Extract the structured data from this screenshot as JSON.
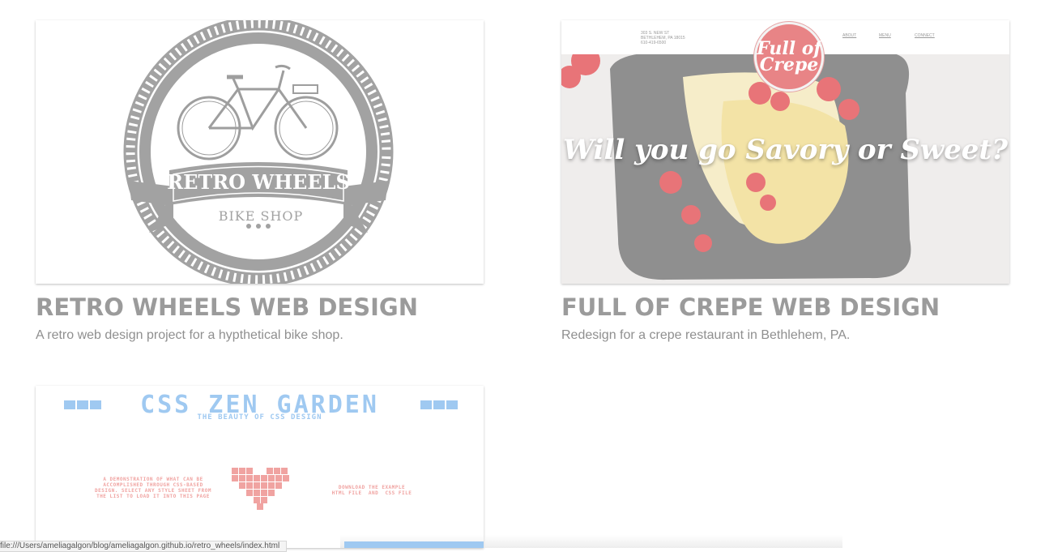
{
  "projects": [
    {
      "title": "RETRO WHEELS WEB DESIGN",
      "description": "A retro web design project for a hypthetical bike shop.",
      "thumbnail": {
        "logo_main_text": "RETRO WHEELS",
        "logo_sub_text": "BIKE SHOP",
        "icon": "bicycle-icon",
        "color": "#9e9e9e"
      }
    },
    {
      "title": "FULL OF CREPE WEB DESIGN",
      "description": "Redesign for a crepe restaurant in Bethlehem, PA.",
      "thumbnail": {
        "address": "303 S. NEW ST\nBETHLEHEM, PA 18015\n610-419-6500",
        "nav": [
          "ABOUT",
          "MENU",
          "CONNECT"
        ],
        "logo_text": "Full of Crepe",
        "tagline": "Will you go Savory or Sweet?",
        "accent": "#e88486"
      }
    },
    {
      "title": "",
      "description": "",
      "thumbnail": {
        "title": "CSS ZEN GARDEN",
        "subtitle": "THE BEAUTY OF CSS DESIGN",
        "left_text": "A DEMONSTRATION OF WHAT CAN BE\nACCOMPLISHED THROUGH CSS-BASED\nDESIGN. SELECT ANY STYLE SHEET FROM\nTHE LIST TO LOAD IT INTO THIS PAGE",
        "right_text": "DOWNLOAD THE EXAMPLE\nHTML FILE  AND  CSS FILE",
        "blue": "#9fc9f1",
        "pink": "#f0a3a1"
      }
    }
  ],
  "status_bar": {
    "url": "file:///Users/ameliagalgon/blog/ameliagalgon.github.io/retro_wheels/index.html"
  }
}
